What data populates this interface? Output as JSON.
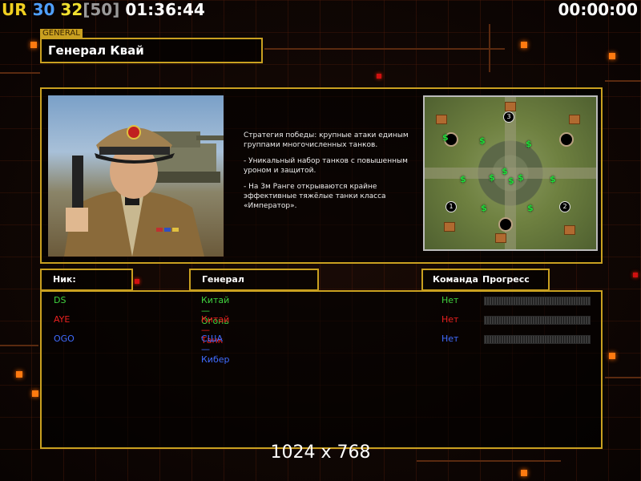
{
  "hud": {
    "parts": [
      {
        "text": "UR",
        "color": "#f0d020"
      },
      {
        "text": " 30",
        "color": "#4fa0ff"
      },
      {
        "text": " 32",
        "color": "#f0e030"
      },
      {
        "text": "[50]",
        "color": "#9a9a9a"
      },
      {
        "text": " 01:36:44",
        "color": "#ffffff"
      }
    ],
    "timer": "00:00:00"
  },
  "general": {
    "tag": "GENERAL",
    "name": "Генерал Квай",
    "description": [
      "Стратегия победы: крупные атаки единым\nгруппами многочисленных танков.",
      "- Уникальный набор танков с повышенным\nуроном и защитой.",
      "- На 3м Ранге открываются крайне\nэффективные тяжёлые танки класса\n«Император»."
    ]
  },
  "headers": {
    "nick": "Ник:",
    "general": "Генерал",
    "team": "Команда",
    "progress": "Прогресс"
  },
  "players": [
    {
      "nick": "DS",
      "general": "Китай — Огонь",
      "team": "Нет",
      "color": "#3fd23f",
      "progress": 0
    },
    {
      "nick": "AYE",
      "general": "Китай — Танк",
      "team": "Нет",
      "color": "#e82020",
      "progress": 0
    },
    {
      "nick": "OGO",
      "general": "США — Кибер",
      "team": "Нет",
      "color": "#3f6cff",
      "progress": 0
    }
  ],
  "map": {
    "start_positions": [
      "1",
      "2",
      "3"
    ],
    "resource_symbol": "$"
  },
  "resolution": "1024 x 768",
  "icons": [
    "general-portrait",
    "minimap"
  ]
}
